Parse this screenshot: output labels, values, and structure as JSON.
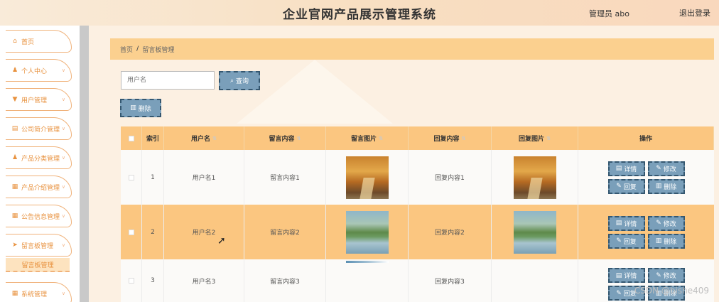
{
  "header": {
    "title": "企业官网产品展示管理系统",
    "admin": "管理员 abo",
    "logout": "退出登录"
  },
  "sidebar": {
    "items": [
      {
        "label": "首页",
        "icon": "home-icon",
        "glyph": "⌂"
      },
      {
        "label": "个人中心",
        "icon": "user-icon",
        "glyph": "♟"
      },
      {
        "label": "用户管理",
        "icon": "trophy-icon",
        "glyph": "▼"
      },
      {
        "label": "公司简介管理",
        "icon": "document-icon",
        "glyph": "▤"
      },
      {
        "label": "产品分类管理",
        "icon": "person-icon",
        "glyph": "♟"
      },
      {
        "label": "产品介绍管理",
        "icon": "grid-icon",
        "glyph": "▦"
      },
      {
        "label": "公告信息管理",
        "icon": "grid-icon",
        "glyph": "▦"
      },
      {
        "label": "留言板管理",
        "icon": "send-icon",
        "glyph": "➤"
      },
      {
        "label": "系统管理",
        "icon": "grid-icon",
        "glyph": "▦"
      }
    ],
    "active_sub": "留言板管理"
  },
  "breadcrumb": {
    "home": "首页",
    "sep": "/",
    "current": "留言板管理"
  },
  "search": {
    "placeholder": "用户名",
    "query_label": "查询",
    "delete_label": "删除"
  },
  "table": {
    "headers": [
      "索引",
      "用户名",
      "留言内容",
      "留言图片",
      "回复内容",
      "回复图片",
      "操作"
    ],
    "rows": [
      {
        "index": "1",
        "username": "用户名1",
        "content": "留言内容1",
        "reply": "回复内容1"
      },
      {
        "index": "2",
        "username": "用户名2",
        "content": "留言内容2",
        "reply": "回复内容2"
      },
      {
        "index": "3",
        "username": "用户名3",
        "content": "留言内容3",
        "reply": "回复内容3"
      }
    ],
    "actions": {
      "detail": "详情",
      "edit": "修改",
      "reply": "回复",
      "delete": "删除"
    }
  },
  "watermark": "CSDN @bishe409",
  "colors": {
    "accent": "#fbc680",
    "button": "#7a9fba",
    "button_border": "#345770",
    "menu_text": "#e8923f"
  }
}
